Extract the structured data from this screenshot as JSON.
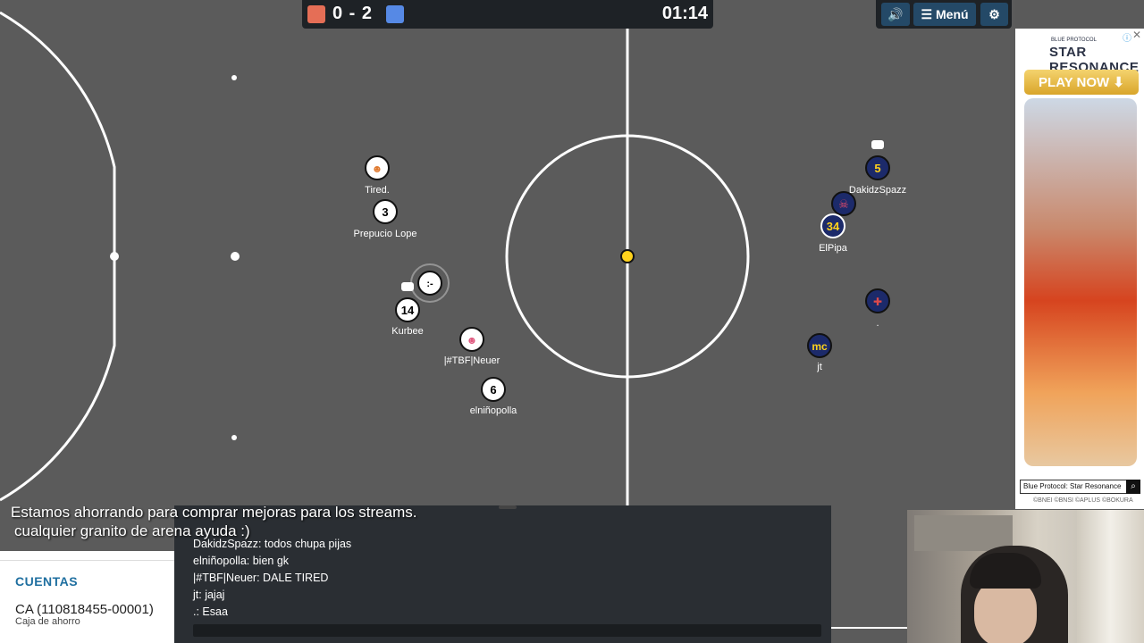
{
  "scoreboard": {
    "score": "0 - 2",
    "clock": "01:14",
    "red_color": "#e56e56",
    "blue_color": "#5689e5"
  },
  "topbar": {
    "sound_icon": "speaker-icon",
    "menu_label": "Menú",
    "settings_icon": "gear-icon"
  },
  "players": [
    {
      "label": "Tired.",
      "avatar": "emoji",
      "team": "white"
    },
    {
      "label": "Prepucio Lope",
      "avatar": "3",
      "team": "white"
    },
    {
      "label": "Kurbee",
      "avatar": "14",
      "team": "white"
    },
    {
      "label": "|#TBF|Neuer",
      "avatar": "emoji",
      "team": "white"
    },
    {
      "label": "elniñopolla",
      "avatar": "6",
      "team": "white"
    },
    {
      "label": "",
      "avatar": ":-",
      "team": "white"
    },
    {
      "label": "DakidzSpazz",
      "avatar": "5",
      "team": "blue"
    },
    {
      "label": "ElPipa",
      "avatar": "34",
      "team": "blue"
    },
    {
      "label": "",
      "avatar": "skull",
      "team": "blue"
    },
    {
      "label": ".",
      "avatar": "flag",
      "team": "blue"
    },
    {
      "label": "jt",
      "avatar": "mc",
      "team": "blue"
    }
  ],
  "overlay": {
    "line1": "Estamos ahorrando para comprar mejoras para los streams.",
    "line2": "cualquier granito de arena ayuda :)"
  },
  "chat": {
    "messages": [
      "DakidzSpazz: todos chupa pijas",
      "elniñopolla: bien gk",
      "|#TBF|Neuer: DALE TIRED",
      "jt: jajaj",
      ".: Esaa"
    ]
  },
  "bank": {
    "title": "CUENTAS",
    "account": "CA (110818455-00001)",
    "type": "Caja de ahorro"
  },
  "ad": {
    "small_text": "BLUE PROTOCOL",
    "title": "STAR RESONANCE",
    "cta": "PLAY NOW ⬇",
    "footer": "Blue Protocol: Star Resonance",
    "copyright": "©BNEI ©BNSI ©APLUS ©BOKURA"
  }
}
